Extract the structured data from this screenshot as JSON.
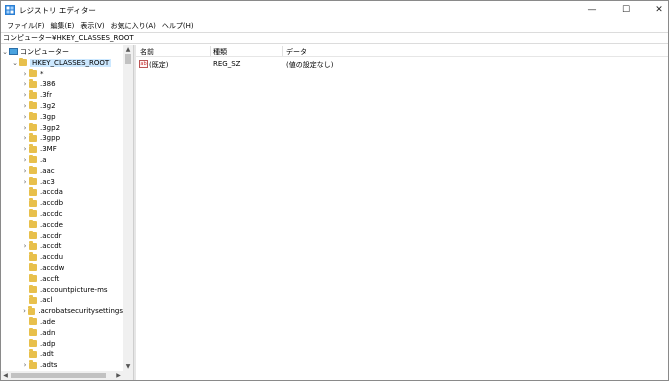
{
  "window": {
    "title": "レジストリ エディター",
    "min_glyph": "—",
    "max_glyph": "☐",
    "close_glyph": "✕"
  },
  "menu": [
    "ファイル(F)",
    "編集(E)",
    "表示(V)",
    "お気に入り(A)",
    "ヘルプ(H)"
  ],
  "address": "コンピューター¥HKEY_CLASSES_ROOT",
  "tree": {
    "root_label": "コンピューター",
    "hive_label": "HKEY_CLASSES_ROOT",
    "items": [
      {
        "label": "*",
        "expandable": true
      },
      {
        "label": ".386",
        "expandable": true
      },
      {
        "label": ".3fr",
        "expandable": true
      },
      {
        "label": ".3g2",
        "expandable": true
      },
      {
        "label": ".3gp",
        "expandable": true
      },
      {
        "label": ".3gp2",
        "expandable": true
      },
      {
        "label": ".3gpp",
        "expandable": true
      },
      {
        "label": ".3MF",
        "expandable": true
      },
      {
        "label": ".a",
        "expandable": true
      },
      {
        "label": ".aac",
        "expandable": true
      },
      {
        "label": ".ac3",
        "expandable": true
      },
      {
        "label": ".accda",
        "expandable": false
      },
      {
        "label": ".accdb",
        "expandable": false
      },
      {
        "label": ".accdc",
        "expandable": false
      },
      {
        "label": ".accde",
        "expandable": false
      },
      {
        "label": ".accdr",
        "expandable": false
      },
      {
        "label": ".accdt",
        "expandable": true
      },
      {
        "label": ".accdu",
        "expandable": false
      },
      {
        "label": ".accdw",
        "expandable": false
      },
      {
        "label": ".accft",
        "expandable": false
      },
      {
        "label": ".accountpicture-ms",
        "expandable": false
      },
      {
        "label": ".acl",
        "expandable": false
      },
      {
        "label": ".acrobatsecuritysettings",
        "expandable": true
      },
      {
        "label": ".ade",
        "expandable": false
      },
      {
        "label": ".adn",
        "expandable": false
      },
      {
        "label": ".adp",
        "expandable": false
      },
      {
        "label": ".adt",
        "expandable": false
      },
      {
        "label": ".adts",
        "expandable": true
      }
    ]
  },
  "list": {
    "headers": {
      "name": "名前",
      "type": "種類",
      "data": "データ"
    },
    "rows": [
      {
        "icon": "string-value-icon",
        "icon_text": "ab",
        "name": "(既定)",
        "type": "REG_SZ",
        "data": "(値の設定なし)"
      }
    ]
  },
  "icons": {
    "expand": "›",
    "collapse": "⌄",
    "scroll_up": "▲",
    "scroll_down": "▼",
    "scroll_left": "◀",
    "scroll_right": "▶"
  }
}
